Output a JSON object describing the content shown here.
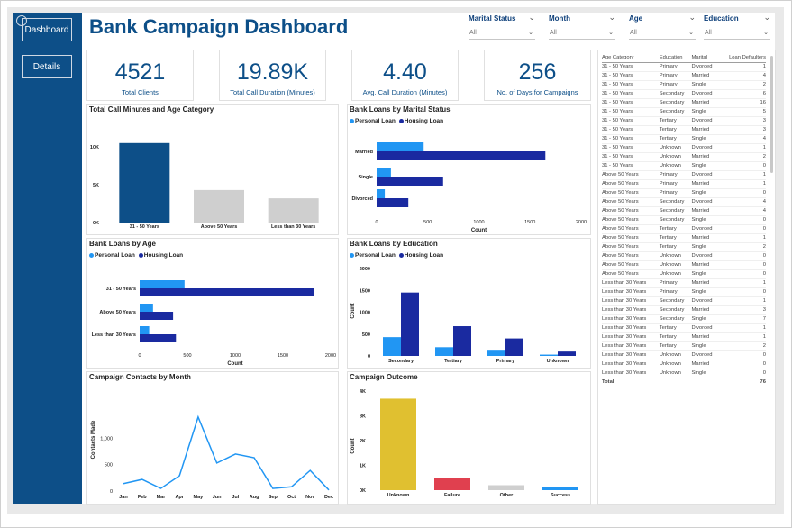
{
  "title": "Bank Campaign Dashboard",
  "nav": [
    {
      "label": "Dashboard",
      "active": true
    },
    {
      "label": "Details",
      "active": false
    }
  ],
  "filters": [
    {
      "label": "Marital Status",
      "value": "All"
    },
    {
      "label": "Month",
      "value": "All"
    },
    {
      "label": "Age",
      "value": "All"
    },
    {
      "label": "Education",
      "value": "All"
    }
  ],
  "kpis": [
    {
      "value": "4521",
      "label": "Total Clients"
    },
    {
      "value": "19.89K",
      "label": "Total Call Duration (Minutes)"
    },
    {
      "value": "4.40",
      "label": "Avg. Call Duration (Minutes)"
    },
    {
      "value": "256",
      "label": "No. of Days for Campaigns"
    }
  ],
  "legend_labels": {
    "personal": "Personal Loan",
    "housing": "Housing Loan"
  },
  "colors": {
    "primary": "#0d4f88",
    "personal": "#2196f3",
    "housing": "#1a2aa0",
    "grey": "#cfcfcf",
    "line": "#2196f3",
    "unknown": "#e0c030",
    "failure": "#e0404f",
    "success": "#2196f3"
  },
  "chart_data": [
    {
      "id": "age_minutes",
      "type": "bar",
      "title": "Total Call Minutes and Age Category",
      "categories": [
        "31 - 50 Years",
        "Above 50 Years",
        "Less than 30 Years"
      ],
      "values": [
        10500,
        4300,
        3200
      ],
      "yticks": [
        "0K",
        "5K",
        "10K"
      ],
      "ylim": [
        0,
        12500
      ]
    },
    {
      "id": "loans_marital",
      "type": "bar",
      "orientation": "horizontal",
      "title": "Bank Loans by Marital Status",
      "categories": [
        "Married",
        "Single",
        "Divorced"
      ],
      "series": [
        {
          "name": "Personal Loan",
          "values": [
            460,
            140,
            80
          ]
        },
        {
          "name": "Housing Loan",
          "values": [
            1650,
            650,
            310
          ]
        }
      ],
      "xticks": [
        "0",
        "500",
        "1000",
        "1500",
        "2000"
      ],
      "xlabel": "Count",
      "xlim": [
        0,
        2000
      ]
    },
    {
      "id": "loans_age",
      "type": "bar",
      "orientation": "horizontal",
      "title": "Bank Loans by Age",
      "categories": [
        "31 - 50 Years",
        "Above 50 Years",
        "Less than 30 Years"
      ],
      "series": [
        {
          "name": "Personal Loan",
          "values": [
            470,
            140,
            100
          ]
        },
        {
          "name": "Housing Loan",
          "values": [
            1830,
            350,
            380
          ]
        }
      ],
      "xticks": [
        "0",
        "500",
        "1000",
        "1500",
        "2000"
      ],
      "xlabel": "Count",
      "xlim": [
        0,
        2000
      ]
    },
    {
      "id": "loans_education",
      "type": "bar",
      "title": "Bank Loans by Education",
      "categories": [
        "Secondary",
        "Tertiary",
        "Primary",
        "Unknown"
      ],
      "series": [
        {
          "name": "Personal Loan",
          "values": [
            430,
            200,
            120,
            30
          ]
        },
        {
          "name": "Housing Loan",
          "values": [
            1450,
            680,
            400,
            100
          ]
        }
      ],
      "yticks": [
        "0",
        "500",
        "1000",
        "1500",
        "2000"
      ],
      "ylabel": "Count",
      "ylim": [
        0,
        2000
      ]
    },
    {
      "id": "contacts_month",
      "type": "line",
      "title": "Campaign Contacts by Month",
      "categories": [
        "Jan",
        "Feb",
        "Mar",
        "Apr",
        "May",
        "Jun",
        "Jul",
        "Aug",
        "Sep",
        "Oct",
        "Nov",
        "Dec"
      ],
      "values": [
        140,
        220,
        50,
        290,
        1400,
        530,
        700,
        630,
        50,
        80,
        390,
        20
      ],
      "yticks": [
        "0",
        "500",
        "1,000"
      ],
      "ylabel": "Contacts Made",
      "ylim": [
        0,
        1500
      ]
    },
    {
      "id": "outcome",
      "type": "bar",
      "title": "Campaign Outcome",
      "categories": [
        "Unknown",
        "Failure",
        "Other",
        "Success"
      ],
      "values": [
        3700,
        490,
        200,
        130
      ],
      "yticks": [
        "0K",
        "1K",
        "2K",
        "3K",
        "4K"
      ],
      "ylabel": "Count",
      "ylim": [
        0,
        4000
      ]
    }
  ],
  "table": {
    "headers": [
      "Age Category",
      "Education",
      "Marital",
      "Loan Defaulters"
    ],
    "rows": [
      [
        "31 - 50 Years",
        "Primary",
        "Divorced",
        "1"
      ],
      [
        "31 - 50 Years",
        "Primary",
        "Married",
        "4"
      ],
      [
        "31 - 50 Years",
        "Primary",
        "Single",
        "2"
      ],
      [
        "31 - 50 Years",
        "Secondary",
        "Divorced",
        "6"
      ],
      [
        "31 - 50 Years",
        "Secondary",
        "Married",
        "16"
      ],
      [
        "31 - 50 Years",
        "Secondary",
        "Single",
        "5"
      ],
      [
        "31 - 50 Years",
        "Tertiary",
        "Divorced",
        "3"
      ],
      [
        "31 - 50 Years",
        "Tertiary",
        "Married",
        "3"
      ],
      [
        "31 - 50 Years",
        "Tertiary",
        "Single",
        "4"
      ],
      [
        "31 - 50 Years",
        "Unknown",
        "Divorced",
        "1"
      ],
      [
        "31 - 50 Years",
        "Unknown",
        "Married",
        "2"
      ],
      [
        "31 - 50 Years",
        "Unknown",
        "Single",
        "0"
      ],
      [
        "Above 50 Years",
        "Primary",
        "Divorced",
        "1"
      ],
      [
        "Above 50 Years",
        "Primary",
        "Married",
        "1"
      ],
      [
        "Above 50 Years",
        "Primary",
        "Single",
        "0"
      ],
      [
        "Above 50 Years",
        "Secondary",
        "Divorced",
        "4"
      ],
      [
        "Above 50 Years",
        "Secondary",
        "Married",
        "4"
      ],
      [
        "Above 50 Years",
        "Secondary",
        "Single",
        "0"
      ],
      [
        "Above 50 Years",
        "Tertiary",
        "Divorced",
        "0"
      ],
      [
        "Above 50 Years",
        "Tertiary",
        "Married",
        "1"
      ],
      [
        "Above 50 Years",
        "Tertiary",
        "Single",
        "2"
      ],
      [
        "Above 50 Years",
        "Unknown",
        "Divorced",
        "0"
      ],
      [
        "Above 50 Years",
        "Unknown",
        "Married",
        "0"
      ],
      [
        "Above 50 Years",
        "Unknown",
        "Single",
        "0"
      ],
      [
        "Less than 30 Years",
        "Primary",
        "Married",
        "1"
      ],
      [
        "Less than 30 Years",
        "Primary",
        "Single",
        "0"
      ],
      [
        "Less than 30 Years",
        "Secondary",
        "Divorced",
        "1"
      ],
      [
        "Less than 30 Years",
        "Secondary",
        "Married",
        "3"
      ],
      [
        "Less than 30 Years",
        "Secondary",
        "Single",
        "7"
      ],
      [
        "Less than 30 Years",
        "Tertiary",
        "Divorced",
        "1"
      ],
      [
        "Less than 30 Years",
        "Tertiary",
        "Married",
        "1"
      ],
      [
        "Less than 30 Years",
        "Tertiary",
        "Single",
        "2"
      ],
      [
        "Less than 30 Years",
        "Unknown",
        "Divorced",
        "0"
      ],
      [
        "Less than 30 Years",
        "Unknown",
        "Married",
        "0"
      ],
      [
        "Less than 30 Years",
        "Unknown",
        "Single",
        "0"
      ]
    ],
    "total_label": "Total",
    "total_value": "76"
  }
}
